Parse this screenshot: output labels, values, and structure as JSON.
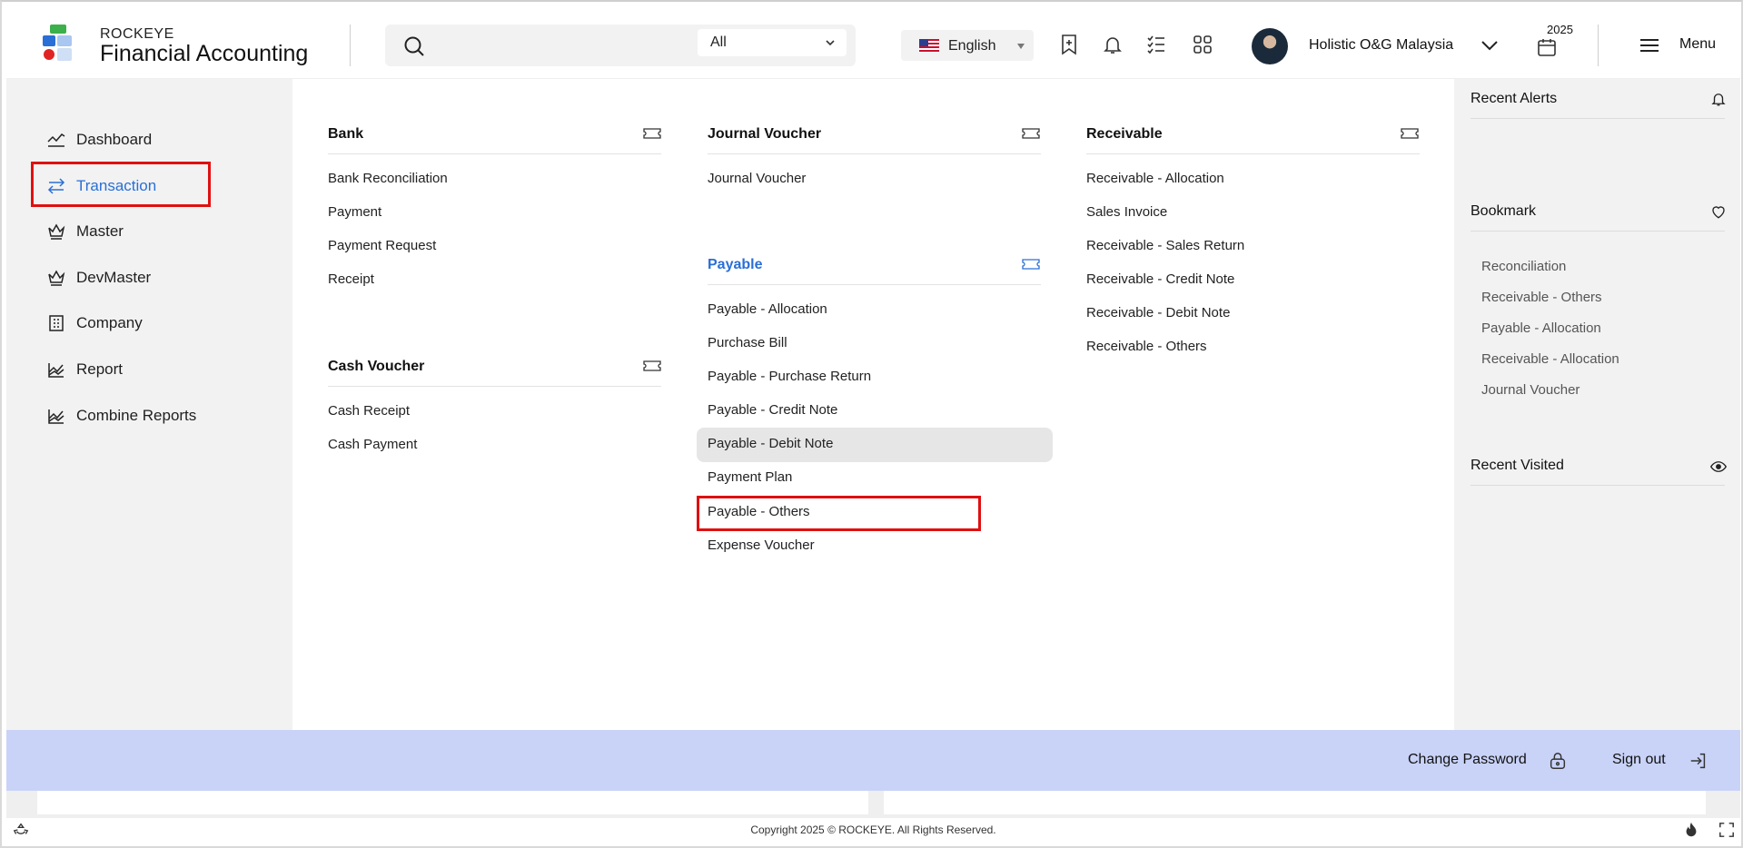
{
  "app": {
    "brand_small": "ROCKEYE",
    "brand_title": "Financial Accounting"
  },
  "header": {
    "search_scope": "All",
    "language": "English",
    "company": "Holistic O&G Malaysia",
    "year": "2025",
    "menu_label": "Menu"
  },
  "sidebar": {
    "items": [
      {
        "label": "Dashboard",
        "icon": "chart-line-icon"
      },
      {
        "label": "Transaction",
        "icon": "transfer-arrows-icon"
      },
      {
        "label": "Master",
        "icon": "crown-icon"
      },
      {
        "label": "DevMaster",
        "icon": "crown-icon"
      },
      {
        "label": "Company",
        "icon": "building-icon"
      },
      {
        "label": "Report",
        "icon": "report-chart-icon"
      },
      {
        "label": "Combine Reports",
        "icon": "report-chart-icon"
      }
    ],
    "active": "Transaction"
  },
  "mega_menu": {
    "bank": {
      "title": "Bank",
      "links": [
        "Bank Reconciliation",
        "Payment",
        "Payment Request",
        "Receipt"
      ]
    },
    "cash_voucher": {
      "title": "Cash Voucher",
      "links": [
        "Cash Receipt",
        "Cash Payment"
      ]
    },
    "journal_voucher": {
      "title": "Journal Voucher",
      "links": [
        "Journal Voucher"
      ]
    },
    "payable": {
      "title": "Payable",
      "links": [
        "Payable - Allocation",
        "Purchase Bill",
        "Payable - Purchase Return",
        "Payable - Credit Note",
        "Payable - Debit Note",
        "Payment Plan",
        "Payable - Others",
        "Expense Voucher"
      ]
    },
    "receivable": {
      "title": "Receivable",
      "links": [
        "Receivable - Allocation",
        "Sales Invoice",
        "Receivable - Sales Return",
        "Receivable - Credit Note",
        "Receivable - Debit Note",
        "Receivable - Others"
      ]
    }
  },
  "right_panel": {
    "recent_alerts": "Recent Alerts",
    "bookmark": "Bookmark",
    "bookmarks": [
      "Reconciliation",
      "Receivable - Others",
      "Payable - Allocation",
      "Receivable - Allocation",
      "Journal Voucher"
    ],
    "recent_visited": "Recent Visited"
  },
  "footer_bar": {
    "change_password": "Change Password",
    "sign_out": "Sign out"
  },
  "footer": {
    "copyright": "Copyright 2025 © ROCKEYE. All Rights Reserved."
  },
  "colors": {
    "accent": "#2a6fd6",
    "highlight_box": "#e01010",
    "footer_bar": "#c9d3f8"
  }
}
